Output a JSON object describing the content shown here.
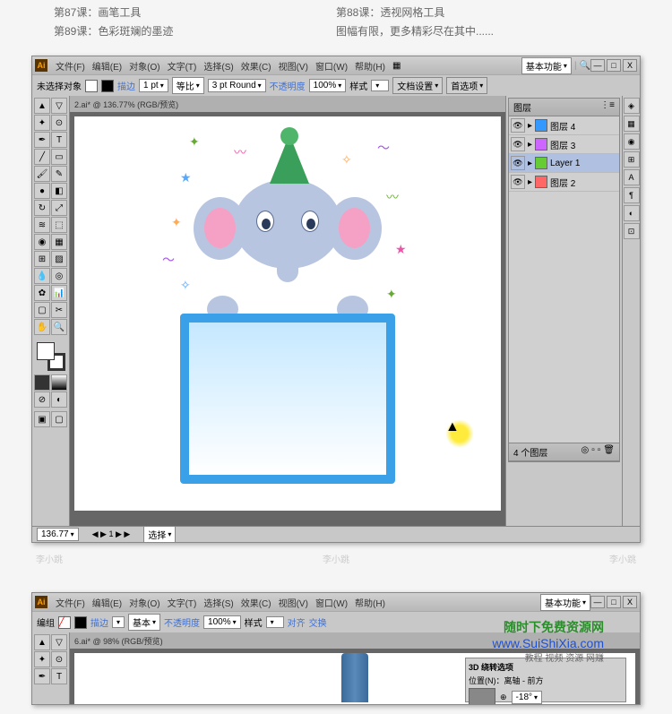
{
  "header": {
    "lesson87": "第87课：画笔工具",
    "lesson88": "第88课：透视网格工具",
    "lesson89": "第89课：色彩斑斓的墨迹",
    "note": "图幅有限，更多精彩尽在其中......"
  },
  "window1": {
    "logo": "Ai",
    "menus": [
      "文件(F)",
      "编辑(E)",
      "对象(O)",
      "文字(T)",
      "选择(S)",
      "效果(C)",
      "视图(V)",
      "窗口(W)",
      "帮助(H)"
    ],
    "workspace": "基本功能",
    "controlbar": {
      "noselection": "未选择对象",
      "stroke_label": "描边",
      "stroke_value": "1 pt",
      "style_label": "等比",
      "brush_value": "3 pt Round",
      "opacity_label": "不透明度",
      "opacity_value": "100%",
      "style2_label": "样式",
      "docsetup": "文档设置",
      "prefs": "首选项"
    },
    "tab": "2.ai* @ 136.77% (RGB/预览)",
    "layers_panel": {
      "title": "图层",
      "layers": [
        {
          "name": "图层 4",
          "color": "#3399ff"
        },
        {
          "name": "图层 3",
          "color": "#cc66ff"
        },
        {
          "name": "Layer 1",
          "color": "#66cc33"
        },
        {
          "name": "图层 2",
          "color": "#ff6666"
        }
      ],
      "footer": "4 个图层"
    },
    "status": {
      "zoom": "136.77",
      "tool": "选择"
    }
  },
  "watermark": "李小跳",
  "window2": {
    "logo": "Ai",
    "menus": [
      "文件(F)",
      "编辑(E)",
      "对象(O)",
      "文字(T)",
      "选择(S)",
      "效果(C)",
      "视图(V)",
      "窗口(W)",
      "帮助(H)"
    ],
    "workspace": "基本功能",
    "controlbar": {
      "noselection": "编组",
      "stroke_label": "描边",
      "style_label": "基本",
      "opacity_label": "不透明度",
      "opacity_value": "100%",
      "style2_label": "样式",
      "align": "对齐",
      "transform": "交换"
    },
    "tab": "6.ai* @ 98% (RGB/预览)",
    "dialog": {
      "title": "3D 绕转选项",
      "position": "位置(N)：离轴 - 前方",
      "angle": "-18°"
    }
  },
  "footer": {
    "line1": "随时下免费资源网",
    "line2": "www.SuiShiXia.com",
    "line3": "教程 视频 资源 网赚"
  }
}
